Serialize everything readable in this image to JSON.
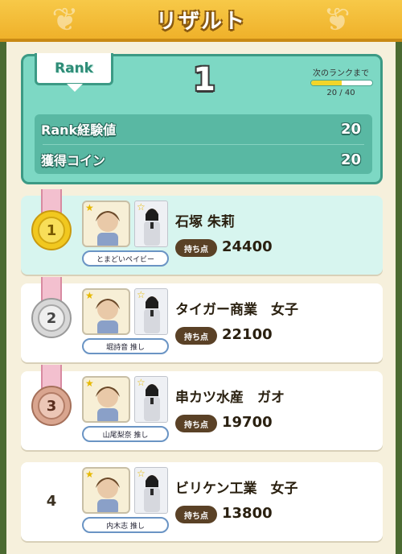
{
  "header": {
    "title": "リザルト"
  },
  "rank": {
    "tag_label": "Rank",
    "value": "1",
    "next_label": "次のランクまで",
    "progress_text": "20 / 40",
    "progress_fraction": 0.5,
    "exp_label": "Rank経験値",
    "exp_value": "20",
    "coin_label": "獲得コイン",
    "coin_value": "20"
  },
  "results": [
    {
      "rank": "1",
      "medal": "gold",
      "name": "石塚 朱莉",
      "pill": "とまどいペイビー",
      "score_label": "持ち点",
      "score": "24400"
    },
    {
      "rank": "2",
      "medal": "silver",
      "name": "タイガー商業　女子",
      "pill": "堀詩音 推し",
      "score_label": "持ち点",
      "score": "22100"
    },
    {
      "rank": "3",
      "medal": "bronze",
      "name": "串カツ水産　ガオ",
      "pill": "山尾梨奈 推し",
      "score_label": "持ち点",
      "score": "19700"
    },
    {
      "rank": "4",
      "medal": "none",
      "name": "ビリケン工業　女子",
      "pill": "内木志 推し",
      "score_label": "持ち点",
      "score": "13800"
    }
  ],
  "colors": {
    "header": "#efb12a",
    "rank_panel": "#7dd8c4",
    "first_card": "#d7f5ef",
    "score_badge": "#5a4126"
  }
}
